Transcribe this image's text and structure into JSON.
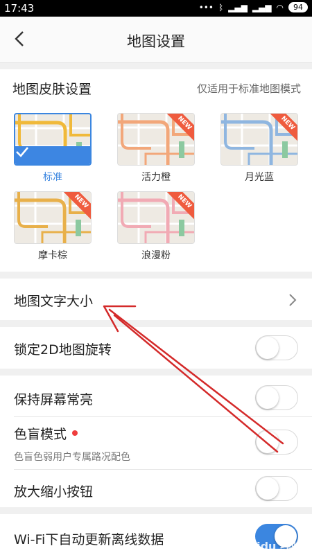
{
  "status_bar": {
    "time": "17:43",
    "battery": "94"
  },
  "nav": {
    "title": "地图设置"
  },
  "skin": {
    "title": "地图皮肤设置",
    "note": "仅适用于标准地图模式",
    "items": [
      {
        "label": "标准",
        "selected": true,
        "is_new": false,
        "color": "#f0b93a"
      },
      {
        "label": "活力橙",
        "selected": false,
        "is_new": true,
        "color": "#f2a77a"
      },
      {
        "label": "月光蓝",
        "selected": false,
        "is_new": true,
        "color": "#8fb6e0"
      },
      {
        "label": "摩卡棕",
        "selected": false,
        "is_new": true,
        "color": "#e8b04a"
      },
      {
        "label": "浪漫粉",
        "selected": false,
        "is_new": true,
        "color": "#f1aab4"
      }
    ],
    "new_badge": "NEW"
  },
  "settings": {
    "text_size": "地图文字大小",
    "lock_2d": "锁定2D地图旋转",
    "screen_on": "保持屏幕常亮",
    "colorblind": "色盲模式",
    "colorblind_sub": "色盲色弱用户专属路况配色",
    "zoom_buttons": "放大缩小按钮",
    "wifi_update": "Wi-Fi下自动更新离线数据"
  },
  "toggles": {
    "lock_2d": false,
    "screen_on": false,
    "colorblind": false,
    "zoom_buttons": false,
    "wifi_update": true
  },
  "colors": {
    "accent": "#3b86e0",
    "annotation": "#d42a2a"
  },
  "watermark": "Baidu 经验"
}
